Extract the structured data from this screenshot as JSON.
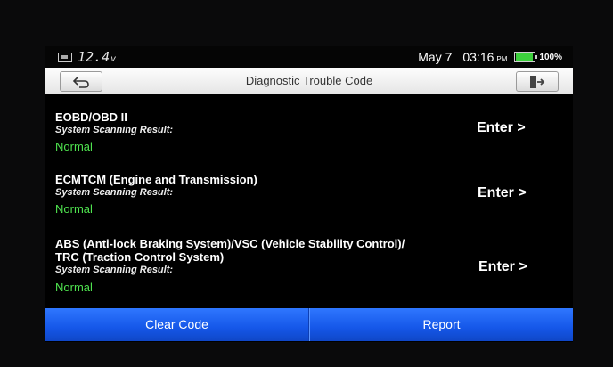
{
  "status": {
    "voltage": "12.4",
    "voltage_unit": "v",
    "date": "May 7",
    "time": "03:16",
    "ampm": "PM",
    "battery_percent": "100%",
    "battery_level": 1.0,
    "battery_color": "#3dd13d"
  },
  "titlebar": {
    "title": "Diagnostic Trouble Code",
    "back_icon": "back-arrow-icon",
    "exit_icon": "exit-door-icon"
  },
  "systems": [
    {
      "name_lines": [
        "EOBD/OBD II"
      ],
      "scan_label": "System Scanning Result:",
      "result": "Normal",
      "enter_label": "Enter >"
    },
    {
      "name_lines": [
        "ECMTCM (Engine and Transmission)"
      ],
      "scan_label": "System Scanning Result:",
      "result": "Normal",
      "enter_label": "Enter >"
    },
    {
      "name_lines": [
        "ABS (Anti-lock Braking System)/VSC (Vehicle Stability Control)/",
        "TRC (Traction Control System)"
      ],
      "scan_label": "System Scanning Result:",
      "result": "Normal",
      "enter_label": "Enter >"
    }
  ],
  "buttons": {
    "clear_code": "Clear Code",
    "report": "Report"
  },
  "colors": {
    "result_normal": "#4fe34f",
    "button_blue": "#1f63f2"
  }
}
